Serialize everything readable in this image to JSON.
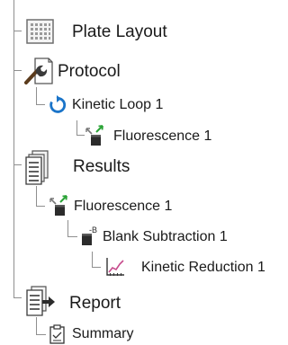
{
  "tree": {
    "plate_layout": {
      "label": "Plate Layout",
      "icon": "plate-grid-icon"
    },
    "protocol": {
      "label": "Protocol",
      "icon": "protocol-wrench-icon",
      "kinetic_loop": {
        "label": "Kinetic Loop 1",
        "icon": "loop-arrow-icon"
      },
      "fluorescence": {
        "label": "Fluorescence 1",
        "icon": "fluorescence-cuvette-icon"
      }
    },
    "results": {
      "label": "Results",
      "icon": "results-document-icon",
      "fluorescence": {
        "label": "Fluorescence 1",
        "icon": "fluorescence-cuvette-icon"
      },
      "blank_subtraction": {
        "label": "Blank Subtraction 1",
        "icon": "blank-subtraction-icon",
        "badge": "-B"
      },
      "kinetic_reduction": {
        "label": "Kinetic Reduction 1",
        "icon": "kinetic-reduction-chart-icon"
      }
    },
    "report": {
      "label": "Report",
      "icon": "report-export-icon",
      "summary": {
        "label": "Summary",
        "icon": "summary-clipboard-icon"
      }
    }
  },
  "colors": {
    "loop_blue": "#1a74c9",
    "green_arrow": "#2aa336",
    "connector_gray": "#8f8f8f",
    "icon_dark": "#2b2b2b"
  }
}
